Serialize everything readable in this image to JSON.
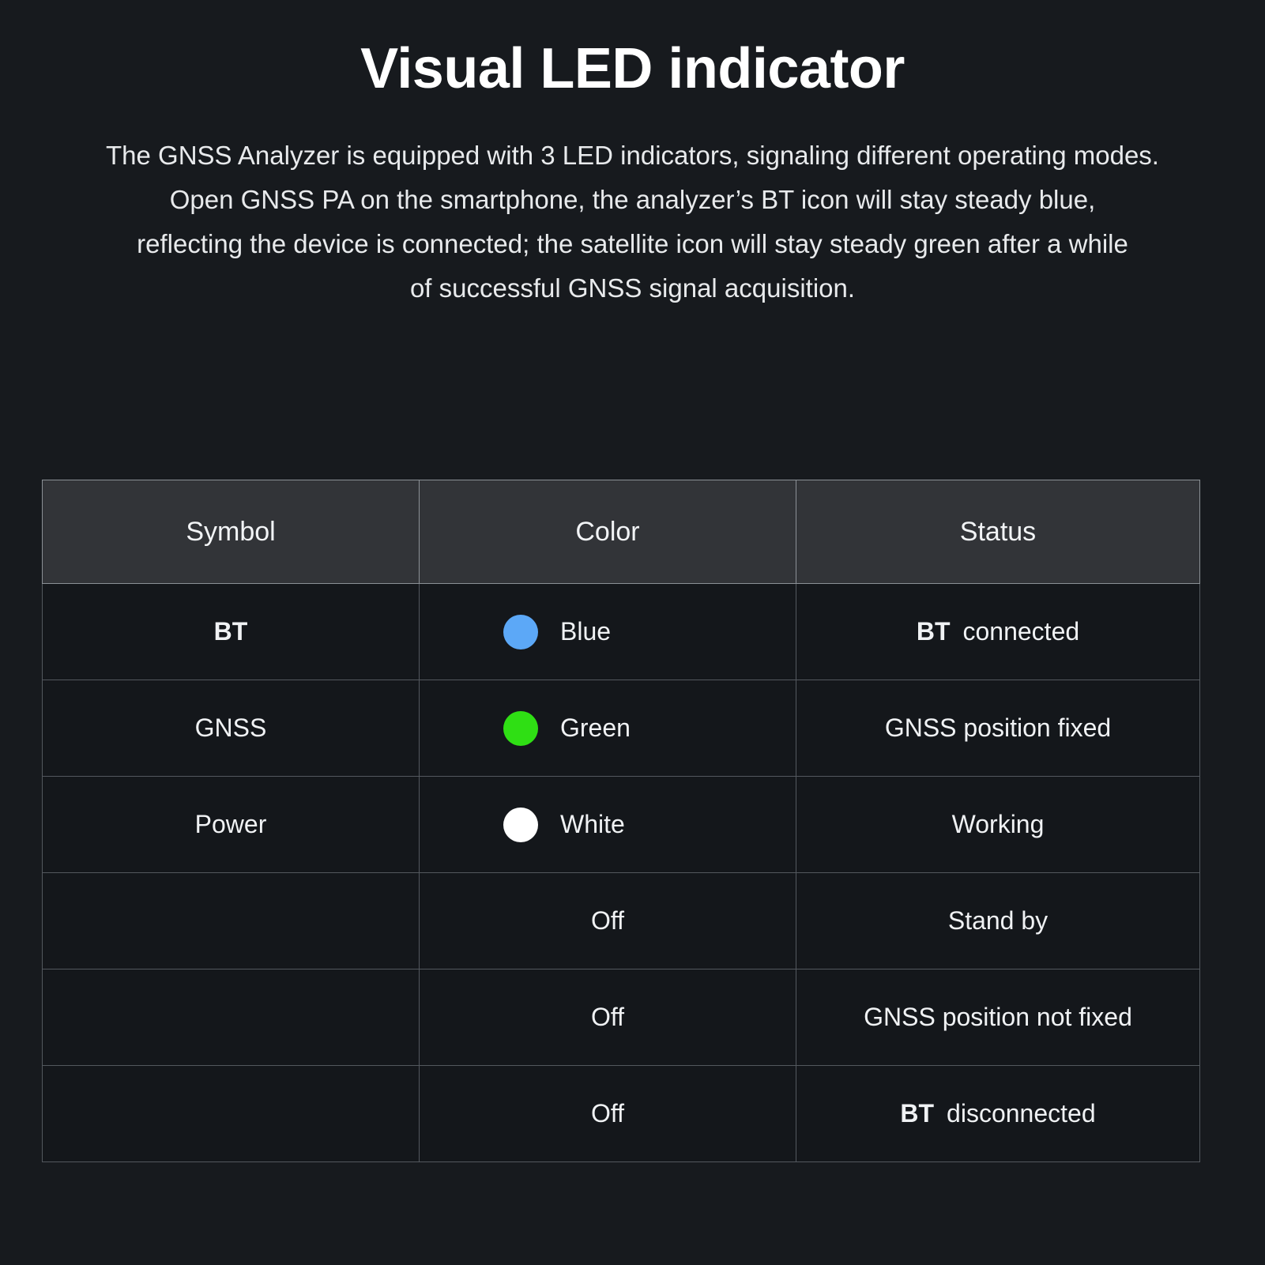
{
  "header": {
    "title": "Visual LED indicator",
    "paragraph_lines": [
      "The GNSS Analyzer is equipped with 3 LED indicators, signaling different operating modes.",
      "Open GNSS PA on the smartphone, the analyzer’s BT icon will stay steady blue,",
      "reflecting the device is connected; the satellite icon will stay steady green after a while",
      "of successful GNSS signal acquisition."
    ]
  },
  "table": {
    "columns": [
      "Symbol",
      "Color",
      "Status"
    ],
    "rows": [
      {
        "symbol": "BT",
        "symbol_bold": true,
        "color_label": "Blue",
        "dot": "blue-led-dot",
        "dot_color": "#5CA8F7",
        "status_prefix": "BT",
        "status_text": "connected"
      },
      {
        "symbol": "GNSS",
        "symbol_bold": false,
        "color_label": "Green",
        "dot": "green-led-dot",
        "dot_color": "#2FDF14",
        "status_prefix": "",
        "status_text": "GNSS position fixed"
      },
      {
        "symbol": "Power",
        "symbol_bold": false,
        "color_label": "White",
        "dot": "white-led-dot",
        "dot_color": "#FFFFFF",
        "status_prefix": "",
        "status_text": "Working"
      },
      {
        "symbol": "",
        "symbol_bold": false,
        "color_label": "Off",
        "dot": "",
        "dot_color": "",
        "status_prefix": "",
        "status_text": "Stand by"
      },
      {
        "symbol": "",
        "symbol_bold": false,
        "color_label": "Off",
        "dot": "",
        "dot_color": "",
        "status_prefix": "",
        "status_text": "GNSS position not fixed"
      },
      {
        "symbol": "",
        "symbol_bold": false,
        "color_label": "Off",
        "dot": "",
        "dot_color": "",
        "status_prefix": "BT",
        "status_text": "disconnected"
      }
    ]
  },
  "theme": {
    "page_background": "#171A1E",
    "header_cell_background": "#323438",
    "body_cell_background": "#14171B",
    "header_border": "#8B9096",
    "body_border": "#53585E",
    "text": "#FFFFFF"
  }
}
